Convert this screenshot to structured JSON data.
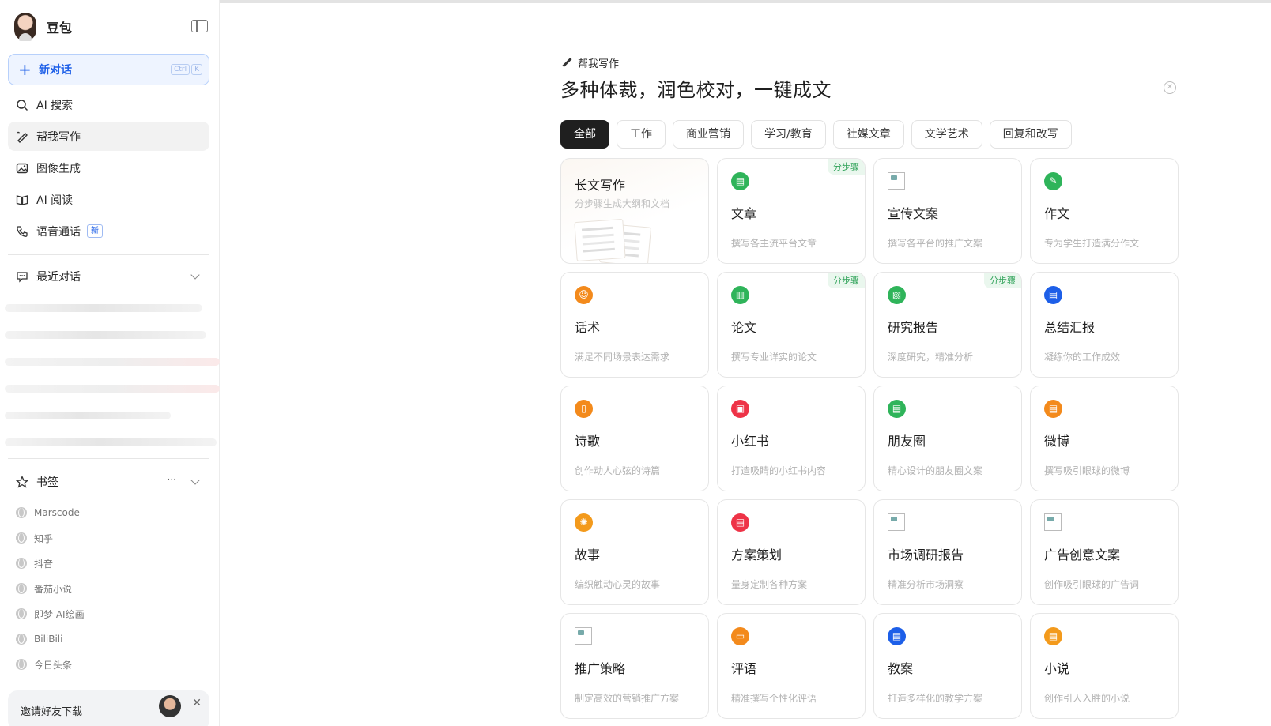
{
  "sidebar": {
    "brand": "豆包",
    "new_chat": "新对话",
    "shortcut": [
      "Ctrl",
      "K"
    ],
    "nav": [
      {
        "label": "AI 搜索",
        "icon": "search-icon"
      },
      {
        "label": "帮我写作",
        "icon": "pen-icon",
        "active": true
      },
      {
        "label": "图像生成",
        "icon": "image-icon"
      },
      {
        "label": "AI 阅读",
        "icon": "book-icon"
      },
      {
        "label": "语音通话",
        "icon": "phone-icon",
        "badge": "新"
      }
    ],
    "recent_label": "最近对话",
    "bookmarks_label": "书签",
    "bookmarks_more": "···",
    "bookmarks": [
      "Marscode",
      "知乎",
      "抖音",
      "番茄小说",
      "即梦 AI绘画",
      "BiliBili",
      "今日头条"
    ],
    "invite_text": "邀请好友下载"
  },
  "header": {
    "tag": "帮我写作",
    "title": "多种体裁，润色校对，一键成文"
  },
  "tabs": [
    "全部",
    "工作",
    "商业营销",
    "学习/教育",
    "社媒文章",
    "文学艺术",
    "回复和改写"
  ],
  "active_tab": "全部",
  "cards": [
    {
      "title": "长文写作",
      "sub": "分步骤生成大纲和文档",
      "kind": "long"
    },
    {
      "title": "文章",
      "sub": "撰写各主流平台文章",
      "icon": "doc-icon",
      "color": "#2fb45a",
      "step": "分步骤"
    },
    {
      "title": "宣传文案",
      "sub": "撰写各平台的推广文案",
      "icon": "broken-image-icon"
    },
    {
      "title": "作文",
      "sub": "专为学生打造满分作文",
      "icon": "pencil-icon",
      "color": "#2fb45a"
    },
    {
      "title": "话术",
      "sub": "满足不同场景表达需求",
      "icon": "speaker-icon",
      "color": "#f38a1c"
    },
    {
      "title": "论文",
      "sub": "撰写专业详实的论文",
      "icon": "chart-icon",
      "color": "#2fb45a",
      "step": "分步骤"
    },
    {
      "title": "研究报告",
      "sub": "深度研究，精准分析",
      "icon": "report-icon",
      "color": "#2fb45a",
      "step": "分步骤"
    },
    {
      "title": "总结汇报",
      "sub": "凝练你的工作成效",
      "icon": "summary-icon",
      "color": "#1d5fe8"
    },
    {
      "title": "诗歌",
      "sub": "创作动人心弦的诗篇",
      "icon": "poem-icon",
      "color": "#f38a1c"
    },
    {
      "title": "小红书",
      "sub": "打造吸睛的小红书内容",
      "icon": "xiaohongshu-icon",
      "color": "#ee3347"
    },
    {
      "title": "朋友圈",
      "sub": "精心设计的朋友圈文案",
      "icon": "moments-icon",
      "color": "#2fb45a"
    },
    {
      "title": "微博",
      "sub": "撰写吸引眼球的微博",
      "icon": "weibo-icon",
      "color": "#f38a1c"
    },
    {
      "title": "故事",
      "sub": "编织触动心灵的故事",
      "icon": "bulb-icon",
      "color": "#f39a1c"
    },
    {
      "title": "方案策划",
      "sub": "量身定制各种方案",
      "icon": "plan-icon",
      "color": "#ee3347"
    },
    {
      "title": "市场调研报告",
      "sub": "精准分析市场洞察",
      "icon": "broken-image-icon"
    },
    {
      "title": "广告创意文案",
      "sub": "创作吸引眼球的广告词",
      "icon": "broken-image-icon"
    },
    {
      "title": "推广策略",
      "sub": "制定高效的营销推广方案",
      "icon": "broken-image-icon"
    },
    {
      "title": "评语",
      "sub": "精准撰写个性化评语",
      "icon": "comment-icon",
      "color": "#f38a1c"
    },
    {
      "title": "教案",
      "sub": "打造多样化的教学方案",
      "icon": "lesson-icon",
      "color": "#1d5fe8"
    },
    {
      "title": "小说",
      "sub": "创作引人入胜的小说",
      "icon": "novel-icon",
      "color": "#f39a1c"
    }
  ]
}
